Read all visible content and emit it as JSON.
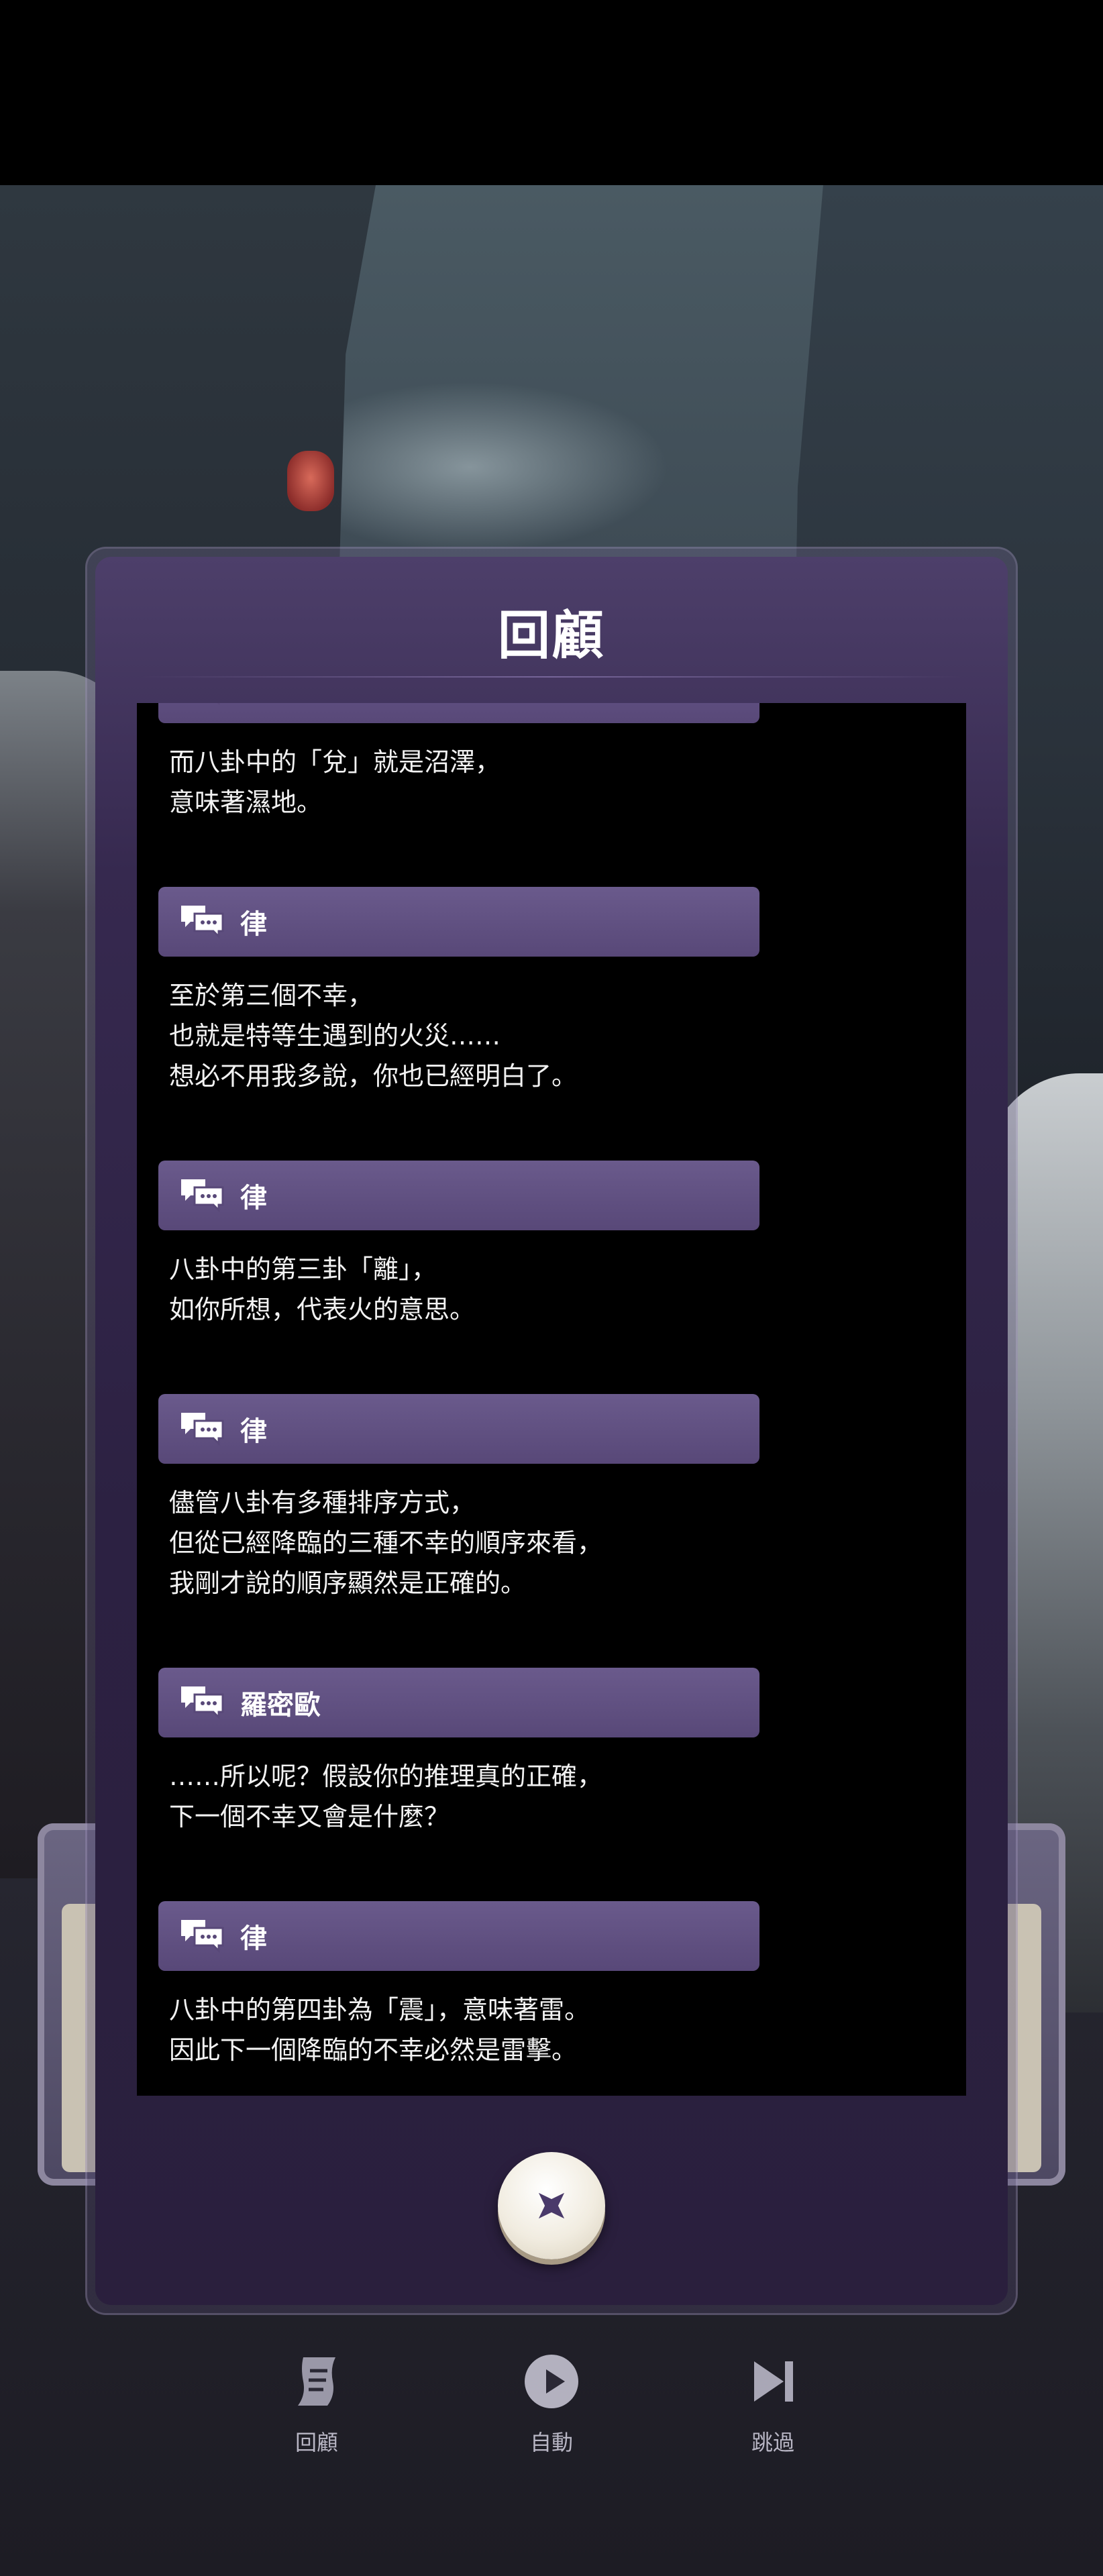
{
  "modal": {
    "title": "回顧",
    "entries": [
      {
        "speaker": "律",
        "lines": [
          "而八卦中的「兌」就是沼澤，",
          "意味著濕地。"
        ]
      },
      {
        "speaker": "律",
        "lines": [
          "至於第三個不幸，",
          "也就是特等生遇到的火災……",
          "想必不用我多說，你也已經明白了。"
        ]
      },
      {
        "speaker": "律",
        "lines": [
          "八卦中的第三卦「離」，",
          "如你所想，代表火的意思。"
        ]
      },
      {
        "speaker": "律",
        "lines": [
          "儘管八卦有多種排序方式，",
          "但從已經降臨的三種不幸的順序來看，",
          "我剛才說的順序顯然是正確的。"
        ]
      },
      {
        "speaker": "羅密歐",
        "lines": [
          "……所以呢？假設你的推理真的正確，",
          "下一個不幸又會是什麼？"
        ]
      },
      {
        "speaker": "律",
        "lines": [
          "八卦中的第四卦為「震」，意味著雷。",
          "因此下一個降臨的不幸必然是雷擊。"
        ]
      }
    ]
  },
  "bottom_menu": {
    "backlog": "回顧",
    "auto": "自動",
    "skip": "跳過"
  },
  "icons": {
    "speaker": "chat-bubbles-icon",
    "close": "close-icon",
    "backlog": "scroll-icon",
    "auto": "play-icon",
    "skip": "skip-icon"
  },
  "colors": {
    "speaker_bar": "#5f4f82",
    "modal_bg": "#2c2142",
    "close_button": "#f1ece0",
    "close_x": "#4a3a6a"
  }
}
